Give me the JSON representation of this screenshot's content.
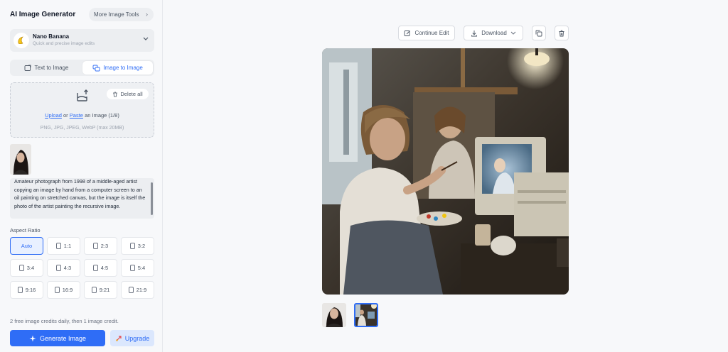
{
  "app": {
    "title": "AI Image Generator",
    "more_tools_label": "More Image Tools"
  },
  "model": {
    "name": "Nano Banana",
    "description": "Quick and precise image edits",
    "icon": "banana-icon"
  },
  "tabs": [
    {
      "label": "Text to Image",
      "active": false
    },
    {
      "label": "Image to Image",
      "active": true
    }
  ],
  "upload": {
    "delete_all_label": "Delete all",
    "upload_link": "Upload",
    "or_text": "or",
    "paste_link": "Paste",
    "count_text": "an Image (1/8)",
    "formats_text": "PNG, JPG, JPEG, WebP (max 20MB)"
  },
  "prompt": {
    "text": "Amateur photograph from 1998 of a middle-aged artist copying an image by hand from a computer screen to an oil painting on stretched canvas, but the image is itself the photo of the artist painting the recursive image."
  },
  "aspect_ratio": {
    "label": "Aspect Ratio",
    "options": [
      "Auto",
      "1:1",
      "2:3",
      "3:2",
      "3:4",
      "4:3",
      "4:5",
      "5:4",
      "9:16",
      "16:9",
      "9:21",
      "21:9"
    ],
    "selected": "Auto"
  },
  "footer": {
    "credits_text": "2 free image credits daily, then 1 image credit.",
    "generate_label": "Generate Image",
    "upgrade_label": "Upgrade"
  },
  "toolbar": {
    "continue_edit_label": "Continue Edit",
    "download_label": "Download"
  },
  "colors": {
    "accent": "#2f6df6",
    "panel_bg": "#f7f8fa",
    "muted_bg": "#eceef1"
  }
}
